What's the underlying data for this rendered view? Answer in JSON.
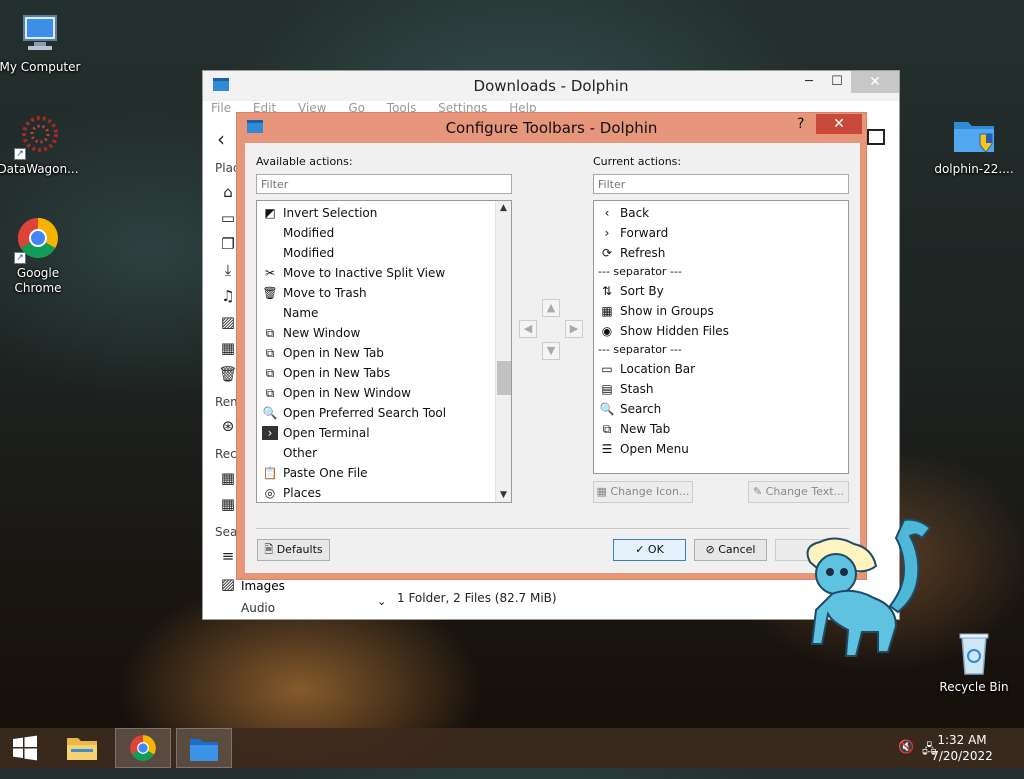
{
  "desktop": {
    "icons": [
      {
        "label": "My Computer"
      },
      {
        "label": "DataWagon..."
      },
      {
        "label": "Google Chrome"
      },
      {
        "label": "dolphin-22...."
      },
      {
        "label": "Recycle Bin"
      }
    ]
  },
  "dolphin_window": {
    "title": "Downloads - Dolphin",
    "menu": [
      "File",
      "Edit",
      "View",
      "Go",
      "Tools",
      "Settings",
      "Help"
    ],
    "places_sections": [
      "Plac",
      "Rem",
      "Rece",
      "Sear"
    ],
    "places_visible": [
      "Images",
      "Audio"
    ],
    "status": "1 Folder, 2 Files (82.7 MiB)"
  },
  "dialog": {
    "title": "Configure Toolbars - Dolphin",
    "help": "?",
    "available_label": "Available actions:",
    "current_label": "Current actions:",
    "available_filter_placeholder": "Filter",
    "current_filter_placeholder": "Filter",
    "available_actions": [
      {
        "label": "Invert Selection",
        "icon": "invert-selection-icon",
        "glyph": "◩"
      },
      {
        "label": "Modified",
        "icon": "",
        "glyph": ""
      },
      {
        "label": "Modified",
        "icon": "",
        "glyph": ""
      },
      {
        "label": "Move to Inactive Split View",
        "icon": "scissors-icon",
        "glyph": "✂"
      },
      {
        "label": "Move to Trash",
        "icon": "trash-icon",
        "glyph": "🗑"
      },
      {
        "label": "Name",
        "icon": "",
        "glyph": ""
      },
      {
        "label": "New Window",
        "icon": "new-window-icon",
        "glyph": "⧉"
      },
      {
        "label": "Open in New Tab",
        "icon": "new-tab-icon",
        "glyph": "⧉"
      },
      {
        "label": "Open in New Tabs",
        "icon": "new-tab-icon",
        "glyph": "⧉"
      },
      {
        "label": "Open in New Window",
        "icon": "new-window-icon",
        "glyph": "⧉"
      },
      {
        "label": "Open Preferred Search Tool",
        "icon": "search-icon",
        "glyph": "🔍"
      },
      {
        "label": "Open Terminal",
        "icon": "terminal-icon",
        "glyph": "›"
      },
      {
        "label": "Other",
        "icon": "",
        "glyph": ""
      },
      {
        "label": "Paste One File",
        "icon": "paste-icon",
        "glyph": "📋"
      },
      {
        "label": "Places",
        "icon": "compass-icon",
        "glyph": "◎"
      }
    ],
    "current_actions": [
      {
        "label": "Back",
        "icon": "chevron-left-icon",
        "glyph": "‹",
        "sep": false
      },
      {
        "label": "Forward",
        "icon": "chevron-right-icon",
        "glyph": "›",
        "sep": false
      },
      {
        "label": "Refresh",
        "icon": "refresh-icon",
        "glyph": "⟳",
        "sep": false
      },
      {
        "label": "--- separator ---",
        "icon": "",
        "glyph": "",
        "sep": true
      },
      {
        "label": "Sort By",
        "icon": "sort-icon",
        "glyph": "⇅",
        "sep": false
      },
      {
        "label": "Show in Groups",
        "icon": "groups-icon",
        "glyph": "▦",
        "sep": false
      },
      {
        "label": "Show Hidden Files",
        "icon": "eye-icon",
        "glyph": "◉",
        "sep": false
      },
      {
        "label": "--- separator ---",
        "icon": "",
        "glyph": "",
        "sep": true
      },
      {
        "label": "Location Bar",
        "icon": "location-bar-icon",
        "glyph": "▭",
        "sep": false
      },
      {
        "label": "Stash",
        "icon": "stash-icon",
        "glyph": "▤",
        "sep": false
      },
      {
        "label": "Search",
        "icon": "search-icon",
        "glyph": "🔍",
        "sep": false
      },
      {
        "label": "New Tab",
        "icon": "new-tab-icon",
        "glyph": "⧉",
        "sep": false
      },
      {
        "label": "Open Menu",
        "icon": "hamburger-menu-icon",
        "glyph": "☰",
        "sep": false
      }
    ],
    "change_icon_label": "Change Icon...",
    "change_text_label": "Change Text...",
    "defaults_label": "Defaults",
    "ok_label": "OK",
    "cancel_label": "Cancel"
  },
  "taskbar": {
    "time": "1:32 AM",
    "date": "7/20/2022"
  }
}
